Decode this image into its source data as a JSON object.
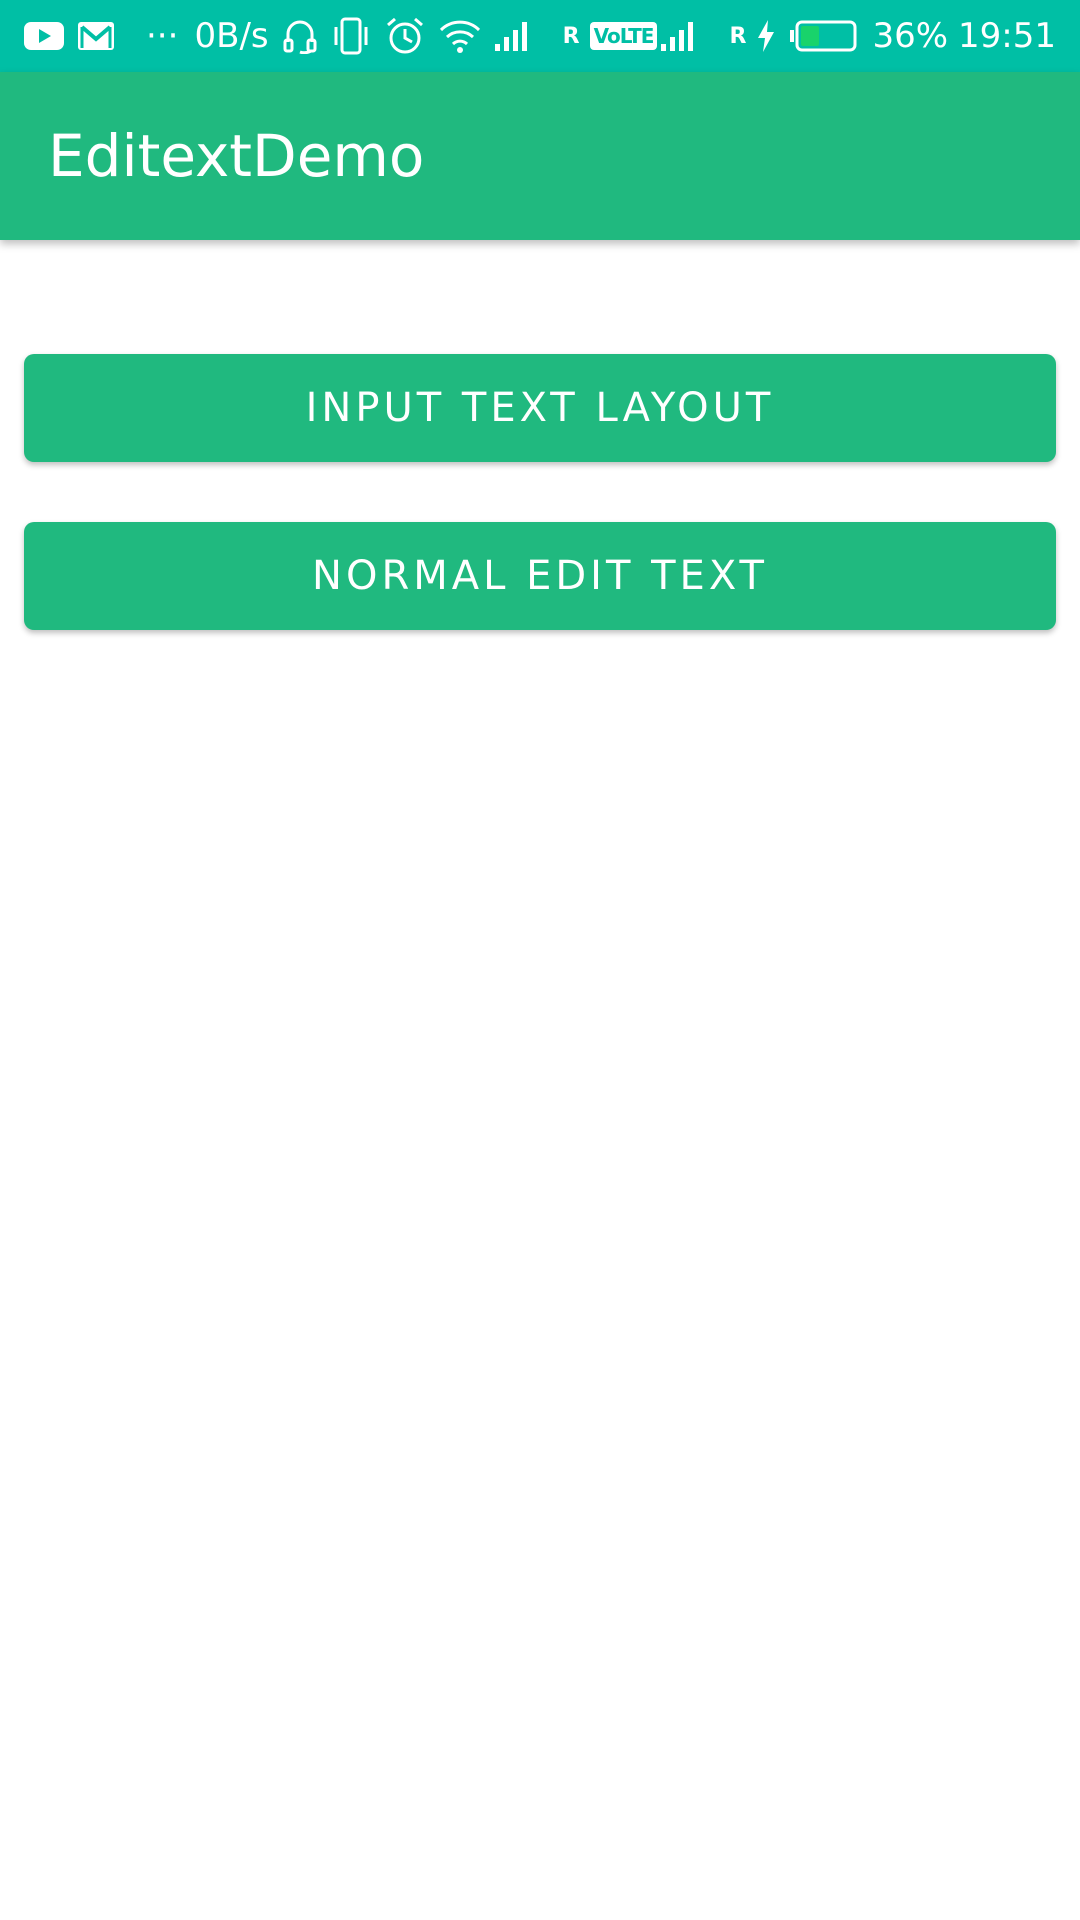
{
  "status_bar": {
    "network_speed": "0B/s",
    "roaming_1": "R",
    "volte": "VoLTE",
    "roaming_2": "R",
    "battery_percent": "36%",
    "time": "19:51",
    "more_dots": "···",
    "battery_level": 0.36,
    "icons": [
      "youtube-icon",
      "gmail-icon",
      "more-icon",
      "headset-icon",
      "vibrate-icon",
      "alarm-icon",
      "wifi-icon",
      "signal-icon",
      "signal-icon-2",
      "charging-icon",
      "battery-icon"
    ]
  },
  "app_bar": {
    "title": "EditextDemo"
  },
  "buttons": {
    "input_text_layout": "INPUT TEXT LAYOUT",
    "normal_edit_text": "NORMAL EDIT TEXT"
  },
  "colors": {
    "status_bar": "#00BFA5",
    "primary": "#20B97F",
    "background": "#FFFFFF",
    "text_on_primary": "#FFFFFF"
  }
}
